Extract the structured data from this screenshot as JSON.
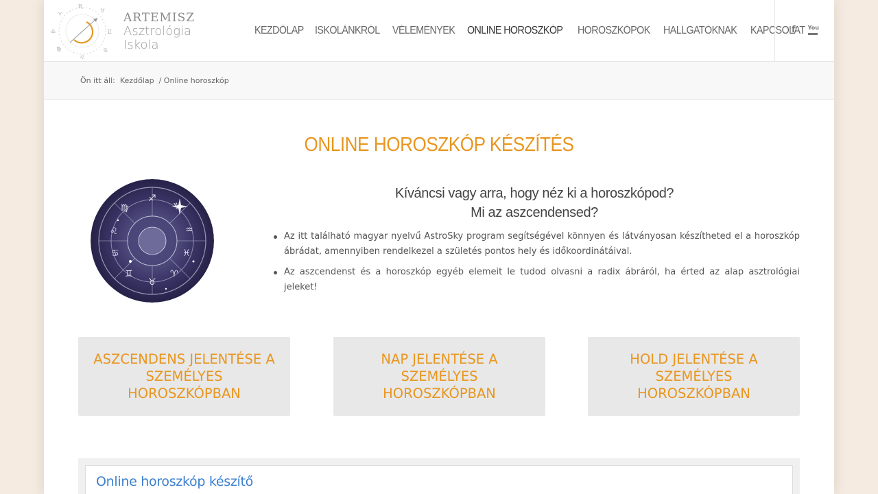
{
  "brand": {
    "line1": "ARTEMISZ",
    "line2": "Asztrológia",
    "line3": "Iskola",
    "accent": "#e8961f"
  },
  "nav": {
    "items": [
      {
        "label": "KEZDŐLAP",
        "active": false
      },
      {
        "label": "ISKOLÁNKRÓL",
        "active": false
      },
      {
        "label": "VÉLEMÉNYEK",
        "active": false
      },
      {
        "label": "ONLINE HOROSZKÓP",
        "active": true
      },
      {
        "label": "HOROSZKÓPOK",
        "active": false
      },
      {
        "label": "HALLGATÓKNAK",
        "active": false
      },
      {
        "label": "KAPCSOLAT",
        "active": false
      }
    ],
    "social": {
      "facebook": "f",
      "youtube": "You"
    }
  },
  "breadcrumb": {
    "prefix": "Ön itt áll:",
    "home": "Kezdőlap",
    "separator": "/",
    "current": "Online horoszkóp"
  },
  "main": {
    "title": "ONLINE HOROSZKÓP KÉSZÍTÉS",
    "question_line1": "Kíváncsi vagy arra, hogy néz ki a horoszkópod?",
    "question_line2": "Mi az aszcendensed?",
    "bullets": [
      "Az itt található magyar nyelvű AstroSky program segítségével könnyen és látványosan készítheted el a horoszkóp ábrádat, amennyiben rendelkezel a születés pontos hely és időkoordinátáival.",
      "Az aszcendenst és a horoszkóp egyéb elemeit le tudod olvasni a radix ábráról, ha érted az alap asztrológiai jeleket!"
    ],
    "cards": [
      "ASZCENDENS JELENTÉSE A SZEMÉLYES HOROSZKÓPBAN",
      "NAP JELENTÉSE A SZEMÉLYES HOROSZKÓPBAN",
      "HOLD JELENTÉSE A SZEMÉLYES HOROSZKÓPBAN"
    ],
    "builder_title": "Online horoszkóp készítő"
  },
  "colors": {
    "background": "#f5ebe1",
    "accent": "#e8961f",
    "card_bg": "#e8e8e8",
    "link_blue": "#3c7fd0"
  }
}
